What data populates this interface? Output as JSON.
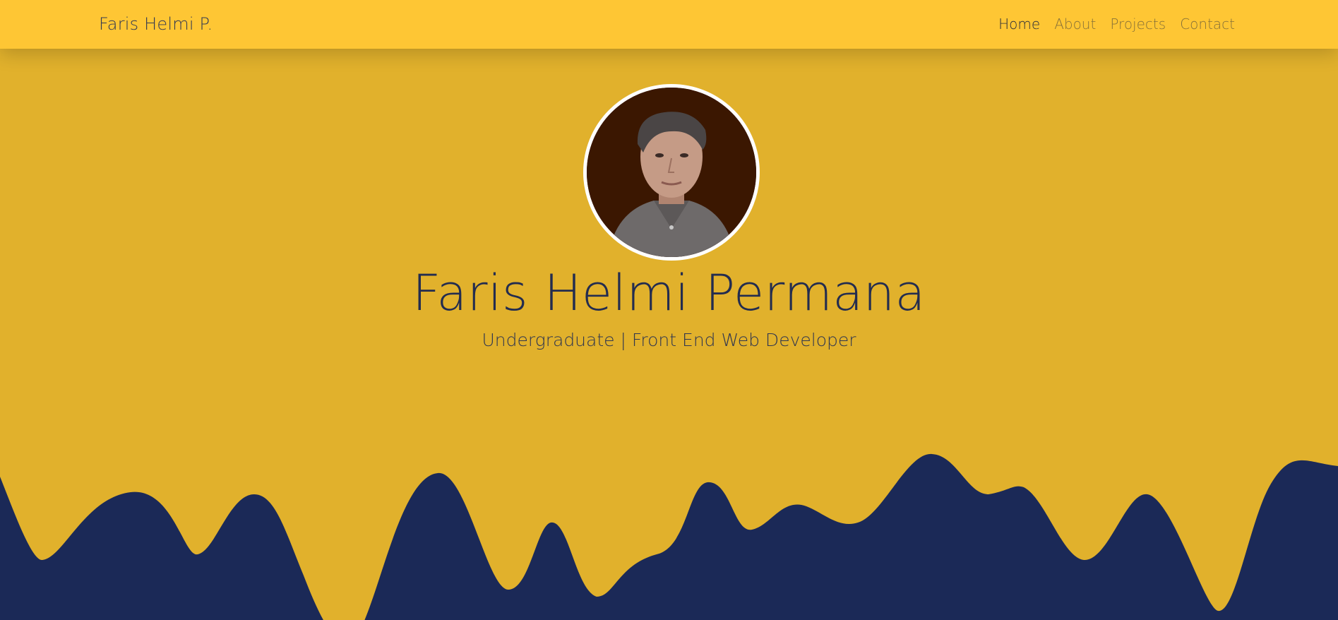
{
  "navbar": {
    "brand": "Faris Helmi P.",
    "links": [
      {
        "label": "Home",
        "active": true
      },
      {
        "label": "About",
        "active": false
      },
      {
        "label": "Projects",
        "active": false
      },
      {
        "label": "Contact",
        "active": false
      }
    ]
  },
  "hero": {
    "name": "Faris Helmi Permana",
    "tagline": "Undergraduate | Front End Web Developer",
    "avatar_alt": "profile-photo"
  },
  "colors": {
    "navbar_bg": "#fec634",
    "hero_bg": "#e1b12c",
    "wave": "#1b2957",
    "text_dark": "#232c4f"
  }
}
